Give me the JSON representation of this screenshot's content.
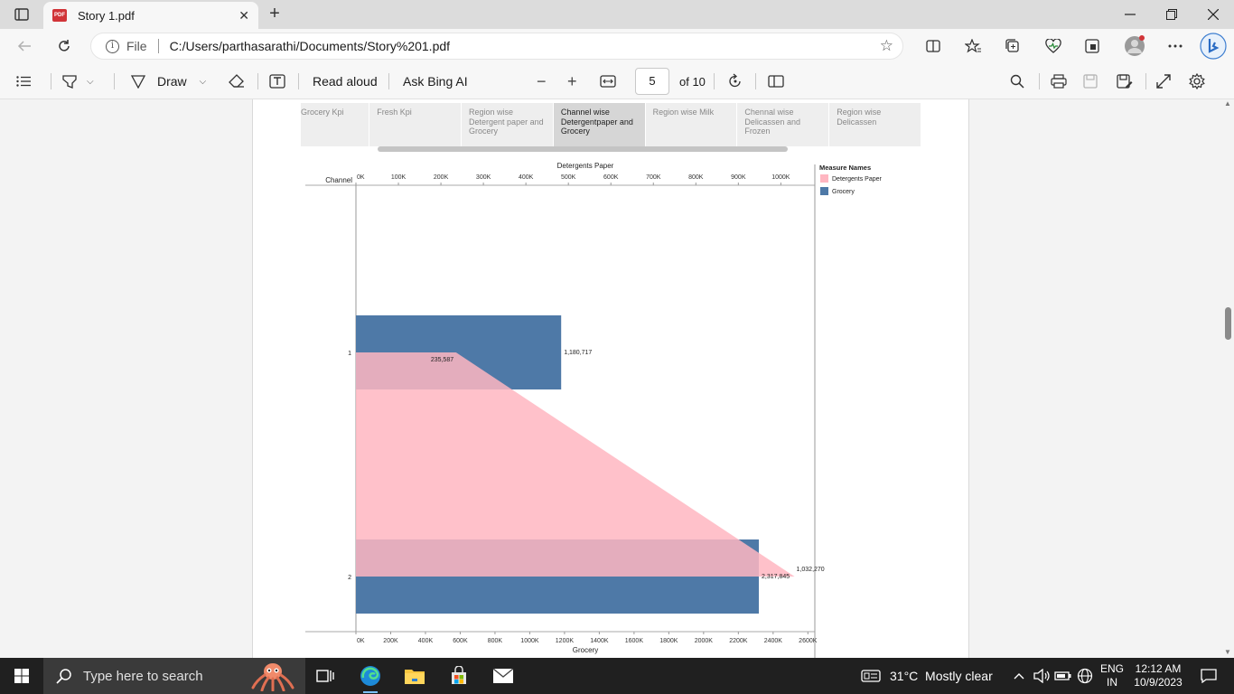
{
  "browser": {
    "tab_title": "Story 1.pdf",
    "pdf_badge": "PDF",
    "new_tab": "+",
    "close_tab": "✕",
    "address": {
      "scheme_label": "File",
      "url": "C:/Users/parthasarathi/Documents/Story%201.pdf"
    }
  },
  "pdf_toolbar": {
    "draw_label": "Draw",
    "read_aloud_label": "Read aloud",
    "ask_ai_label": "Ask Bing AI",
    "page_number": "5",
    "page_total": "of 10"
  },
  "story": {
    "tabs": [
      {
        "label": "Grocery Kpi",
        "active": false
      },
      {
        "label": "Fresh Kpi",
        "active": false
      },
      {
        "label": "Region wise Detergent paper and Grocery",
        "active": false
      },
      {
        "label": "Channel wise Detergentpaper and Grocery",
        "active": true
      },
      {
        "label": "Region wise Milk",
        "active": false
      },
      {
        "label": "Chennal wise Delicassen and Frozen",
        "active": false
      },
      {
        "label": "Region wise Delicassen",
        "active": false
      }
    ]
  },
  "chart_data": {
    "type": "bar",
    "top_axis_title": "Detergents Paper",
    "bottom_axis_title": "Grocery",
    "row_header": "Channel",
    "categories": [
      "1",
      "2"
    ],
    "top_ticks": [
      "0K",
      "100K",
      "200K",
      "300K",
      "400K",
      "500K",
      "600K",
      "700K",
      "800K",
      "900K",
      "1000K"
    ],
    "top_range": [
      0,
      1080000
    ],
    "bottom_ticks": [
      "0K",
      "200K",
      "400K",
      "600K",
      "800K",
      "1000K",
      "1200K",
      "1400K",
      "1600K",
      "1800K",
      "2000K",
      "2200K",
      "2400K",
      "2600K"
    ],
    "bottom_range": [
      0,
      2640000
    ],
    "series": [
      {
        "name": "Detergents Paper",
        "color": "#ffb6c1",
        "values": [
          235587,
          1032270
        ],
        "labels": [
          "235,587",
          "1,032,270"
        ]
      },
      {
        "name": "Grocery",
        "color": "#4e79a7",
        "values": [
          1180717,
          2317845
        ],
        "labels": [
          "1,180,717",
          "2,317,845"
        ]
      }
    ],
    "legend": {
      "title": "Measure Names",
      "placement": "top-right"
    }
  },
  "taskbar": {
    "search_placeholder": "Type here to search",
    "weather": "31°C  Mostly clear",
    "lang_line1": "ENG",
    "lang_line2": "IN",
    "time": "12:12 AM",
    "date": "10/9/2023"
  }
}
